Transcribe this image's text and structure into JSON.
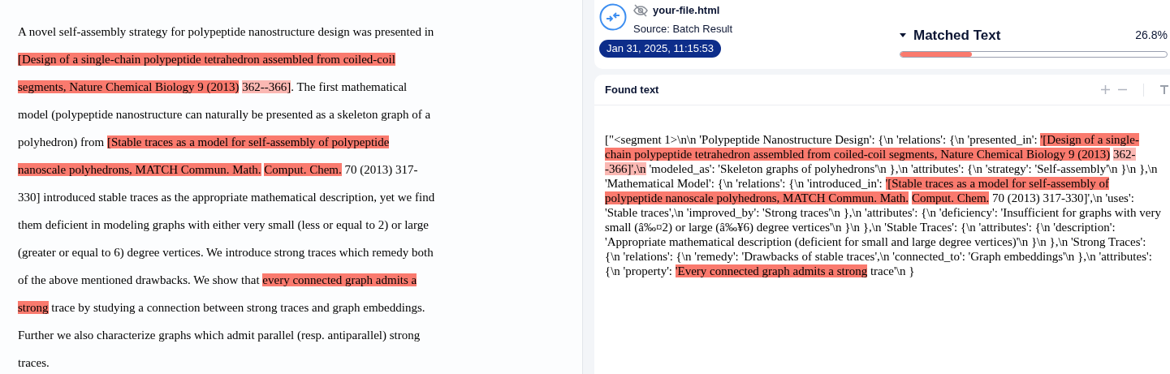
{
  "document": {
    "segments": [
      {
        "text": "A novel self-assembly strategy for polypeptide nanostructure design was presented in "
      },
      {
        "text": "[Design of a single-chain polypeptide tetrahedron assembled from coiled-coil segments, Nature Chemical Biology 9 (2013)",
        "color": "#fa7a6e",
        "space_after": true
      },
      {
        "text": "362--366]",
        "color": "#fbb8b3"
      },
      {
        "text": ". The first mathematical model (polypeptide nanostructure can naturally be presented as a skeleton graph of a polyhedron) from "
      },
      {
        "text": "[Stable traces as a model for self-assembly of polypeptide nanoscale polyhedrons, MATCH Commun. Math.",
        "color": "#fa7a6e",
        "space_after": true
      },
      {
        "text": "Comput. Chem.",
        "color": "#fa7a6e"
      },
      {
        "text": " 70 (2013) 317-330] introduced stable traces as the appropriate mathematical description, yet we find them deficient in modeling graphs with either very small (less or equal to 2) or large (greater or equal to 6) degree vertices. We introduce strong traces which remedy both of the above mentioned drawbacks. We show that "
      },
      {
        "text": "every connected graph admits a strong",
        "color": "#fa7a6e"
      },
      {
        "text": " trace by studying a connection between strong traces and graph embeddings. Further we also characterize graphs which admit parallel (resp. antiparallel) strong traces."
      }
    ]
  },
  "header": {
    "file_name": "your-file.html",
    "source": "Source: Batch Result",
    "date": "Jan 31, 2025, 11:15:53",
    "matched_title": "Matched Text",
    "matched_percent": "26.8%",
    "level": 0.268
  },
  "found_text": {
    "title": "Found text",
    "segments": [
      {
        "text": "[\"<segment 1>\\n\\n 'Polypeptide Nanostructure Design': {\\n 'relations': {\\n 'presented_in': "
      },
      {
        "text": "'[Design of a single-chain polypeptide tetrahedron assembled from coiled-coil segments, Nature Chemical Biology 9 (2013)",
        "color": "#fa7a6e",
        "space_after": true
      },
      {
        "text": "362--366]',\\n",
        "color": "#fbb8b3"
      },
      {
        "text": " 'modeled_as': 'Skeleton graphs of polyhedrons'\\n },\\n 'attributes': {\\n 'strategy': 'Self-assembly'\\n }\\n },\\n 'Mathematical Model': {\\n 'relations': {\\n 'introduced_in': "
      },
      {
        "text": "'[Stable traces as a model for self-assembly of polypeptide nanoscale polyhedrons, MATCH Commun. Math.",
        "color": "#fa7a6e",
        "space_after": true
      },
      {
        "text": "Comput. Chem.",
        "color": "#fa7a6e"
      },
      {
        "text": " 70 (2013) 317-330]',\\n 'uses': 'Stable traces',\\n 'improved_by': 'Strong traces'\\n },\\n 'attributes': {\\n 'deficiency': 'Insufficient for graphs with very small (â‰¤2) or large (â‰¥6) degree vertices'\\n }\\n },\\n 'Stable Traces': {\\n 'attributes': {\\n 'description': 'Appropriate mathematical description (deficient for small and large degree vertices)'\\n }\\n },\\n 'Strong Traces': {\\n 'relations': {\\n 'remedy': 'Drawbacks of stable traces',\\n 'connected_to': 'Graph embeddings'\\n },\\n 'attributes': {\\n 'property': "
      },
      {
        "text": "'Every connected graph admits a strong",
        "color": "#fa7a6e"
      },
      {
        "text": " trace'\\n }"
      }
    ]
  }
}
